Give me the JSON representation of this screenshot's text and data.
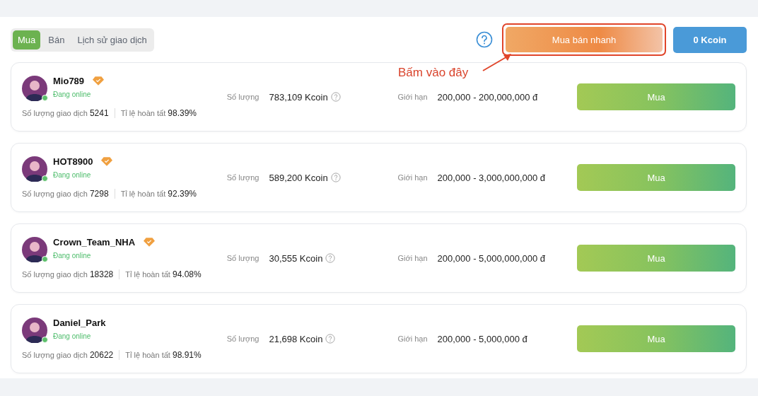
{
  "tabs": [
    {
      "label": "Mua",
      "selected": true
    },
    {
      "label": "Bán",
      "selected": false
    },
    {
      "label": "Lịch sử giao dịch",
      "selected": false
    }
  ],
  "quick_trade_button": {
    "label": "Mua bán nhanh",
    "highlighted": true
  },
  "balance_button": {
    "label": "0 Kcoin"
  },
  "annotation": {
    "text": "Bấm vào đây"
  },
  "offers": [
    {
      "name": "Mio789",
      "verified": true,
      "online": true,
      "status": "Đang online",
      "trades_label": "Số lượng giao dịch",
      "trades": "5241",
      "completion_label": "Tỉ lệ hoàn tất",
      "completion": "98.39%",
      "quantity_label": "Số lượng",
      "quantity": "783,109 Kcoin",
      "limit_label": "Giới hạn",
      "limit": "200,000 - 200,000,000 đ",
      "button": "Mua"
    },
    {
      "name": "HOT8900",
      "verified": true,
      "online": true,
      "status": "Đang online",
      "trades_label": "Số lượng giao dịch",
      "trades": "7298",
      "completion_label": "Tỉ lệ hoàn tất",
      "completion": "92.39%",
      "quantity_label": "Số lượng",
      "quantity": "589,200 Kcoin",
      "limit_label": "Giới hạn",
      "limit": "200,000 - 3,000,000,000 đ",
      "button": "Mua"
    },
    {
      "name": "Crown_Team_NHA",
      "verified": true,
      "online": true,
      "status": "Đang online",
      "trades_label": "Số lượng giao dịch",
      "trades": "18328",
      "completion_label": "Tỉ lệ hoàn tất",
      "completion": "94.08%",
      "quantity_label": "Số lượng",
      "quantity": "30,555 Kcoin",
      "limit_label": "Giới hạn",
      "limit": "200,000 - 5,000,000,000 đ",
      "button": "Mua"
    },
    {
      "name": "Daniel_Park",
      "verified": false,
      "online": true,
      "status": "Đang online",
      "trades_label": "Số lượng giao dịch",
      "trades": "20622",
      "completion_label": "Tỉ lệ hoàn tất",
      "completion": "98.91%",
      "quantity_label": "Số lượng",
      "quantity": "21,698 Kcoin",
      "limit_label": "Giới hạn",
      "limit": "200,000 - 5,000,000 đ",
      "button": "Mua"
    }
  ]
}
